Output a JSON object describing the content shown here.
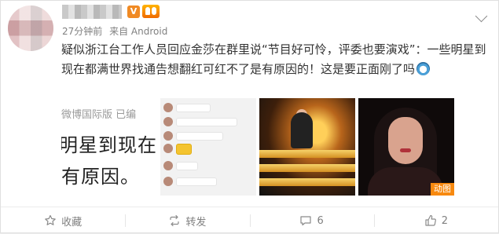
{
  "post": {
    "author_name": "",
    "verified_badge": "V",
    "time": "27分钟前",
    "source": "来自 Android",
    "text": "疑似浙江台工作人员回应金莎在群里说“节目好可怜，评委也要演戏”：一些明星到现在都满世界找通告想翻红可红不了是有原因的！这是要正面刚了吗",
    "emoji_icon": "face-emoji-icon"
  },
  "images": [
    {
      "line1": "微博国际版  已编",
      "line2": "明星到现在都",
      "line3": "有原因。"
    },
    {
      "kind": "chat-screenshot"
    },
    {
      "kind": "stage-photo"
    },
    {
      "kind": "portrait",
      "gif_label": "动图"
    }
  ],
  "actions": {
    "favorite": "收藏",
    "repost": "转发",
    "comment_count": "6",
    "like_count": "2"
  },
  "colors": {
    "accent": "#f08a24",
    "text": "#333333",
    "meta": "#808080",
    "gif_badge": "#f7890f"
  }
}
